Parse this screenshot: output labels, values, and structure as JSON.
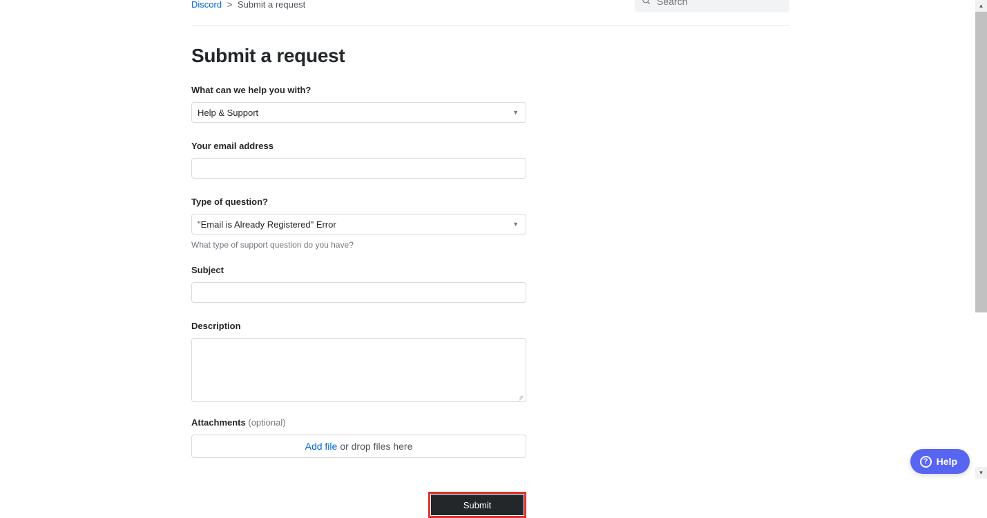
{
  "breadcrumbs": {
    "root": "Discord",
    "sep": ">",
    "current": "Submit a request"
  },
  "search": {
    "placeholder": "Search"
  },
  "page_title": "Submit a request",
  "form": {
    "help_with": {
      "label": "What can we help you with?",
      "value": "Help & Support"
    },
    "email": {
      "label": "Your email address",
      "value": ""
    },
    "question_type": {
      "label": "Type of question?",
      "value": "\"Email is Already Registered\" Error",
      "hint": "What type of support question do you have?"
    },
    "subject": {
      "label": "Subject",
      "value": ""
    },
    "description": {
      "label": "Description",
      "value": ""
    },
    "attachments": {
      "label": "Attachments",
      "optional": "(optional)",
      "add_link": "Add file",
      "suffix": "or drop files here"
    },
    "submit": "Submit"
  },
  "help_widget": {
    "label": "Help"
  }
}
